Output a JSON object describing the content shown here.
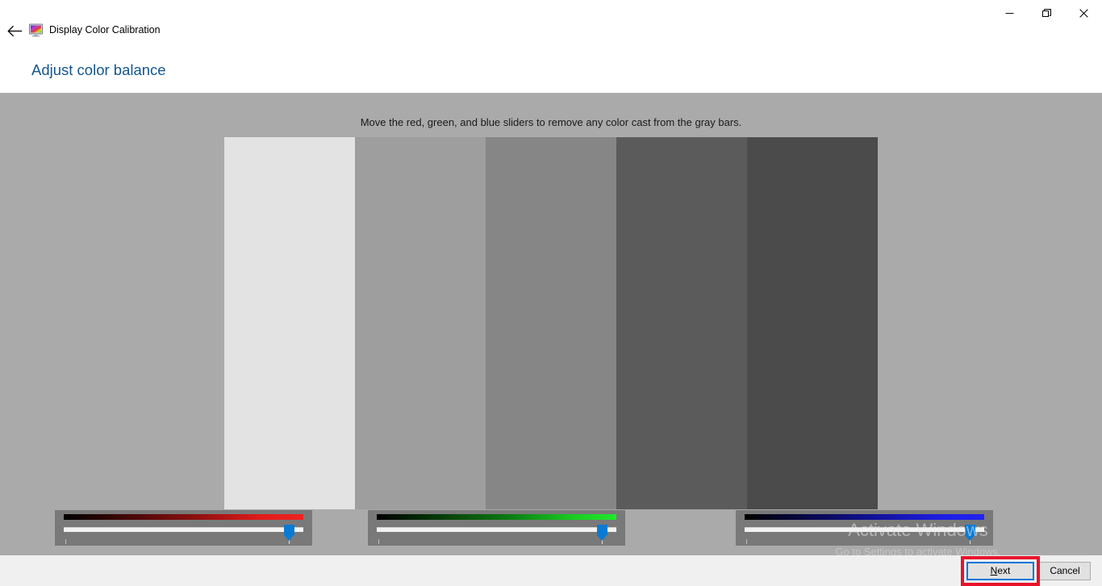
{
  "window": {
    "app_title": "Display Color Calibration",
    "app_icon": "monitor-color-icon",
    "back_icon": "back-arrow-icon",
    "controls": {
      "minimize_label": "—",
      "minimize_name": "minimize-icon",
      "restore_label": "❐",
      "restore_name": "restore-icon",
      "close_label": "✕",
      "close_name": "close-icon"
    }
  },
  "page": {
    "heading": "Adjust color balance",
    "instruction": "Move the red, green, and blue sliders to remove any color cast from the gray bars."
  },
  "gray_bars": {
    "colors": [
      "#e3e3e3",
      "#9e9e9e",
      "#868686",
      "#5b5b5b",
      "#4b4b4b"
    ]
  },
  "sliders": [
    {
      "channel": "red",
      "label": "Red",
      "value_percent": 96,
      "track_color": "#f02222"
    },
    {
      "channel": "green",
      "label": "Green",
      "value_percent": 96,
      "track_color": "#22e82c"
    },
    {
      "channel": "blue",
      "label": "Blue",
      "value_percent": 96,
      "track_color": "#2222f2"
    }
  ],
  "watermark": {
    "title": "Activate Windows",
    "subtitle": "Go to Settings to activate Windows."
  },
  "footer": {
    "next_accel": "N",
    "next_rest": "ext",
    "cancel_label": "Cancel"
  }
}
